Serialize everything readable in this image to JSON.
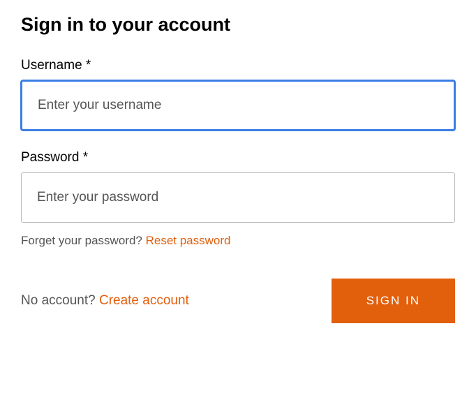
{
  "title": "Sign in to your account",
  "username": {
    "label": "Username *",
    "placeholder": "Enter your username",
    "value": ""
  },
  "password": {
    "label": "Password *",
    "placeholder": "Enter your password",
    "value": ""
  },
  "forgot": {
    "question": "Forget your password? ",
    "link": "Reset password"
  },
  "noaccount": {
    "question": "No account? ",
    "link": "Create account"
  },
  "signin_button": "SIGN IN"
}
